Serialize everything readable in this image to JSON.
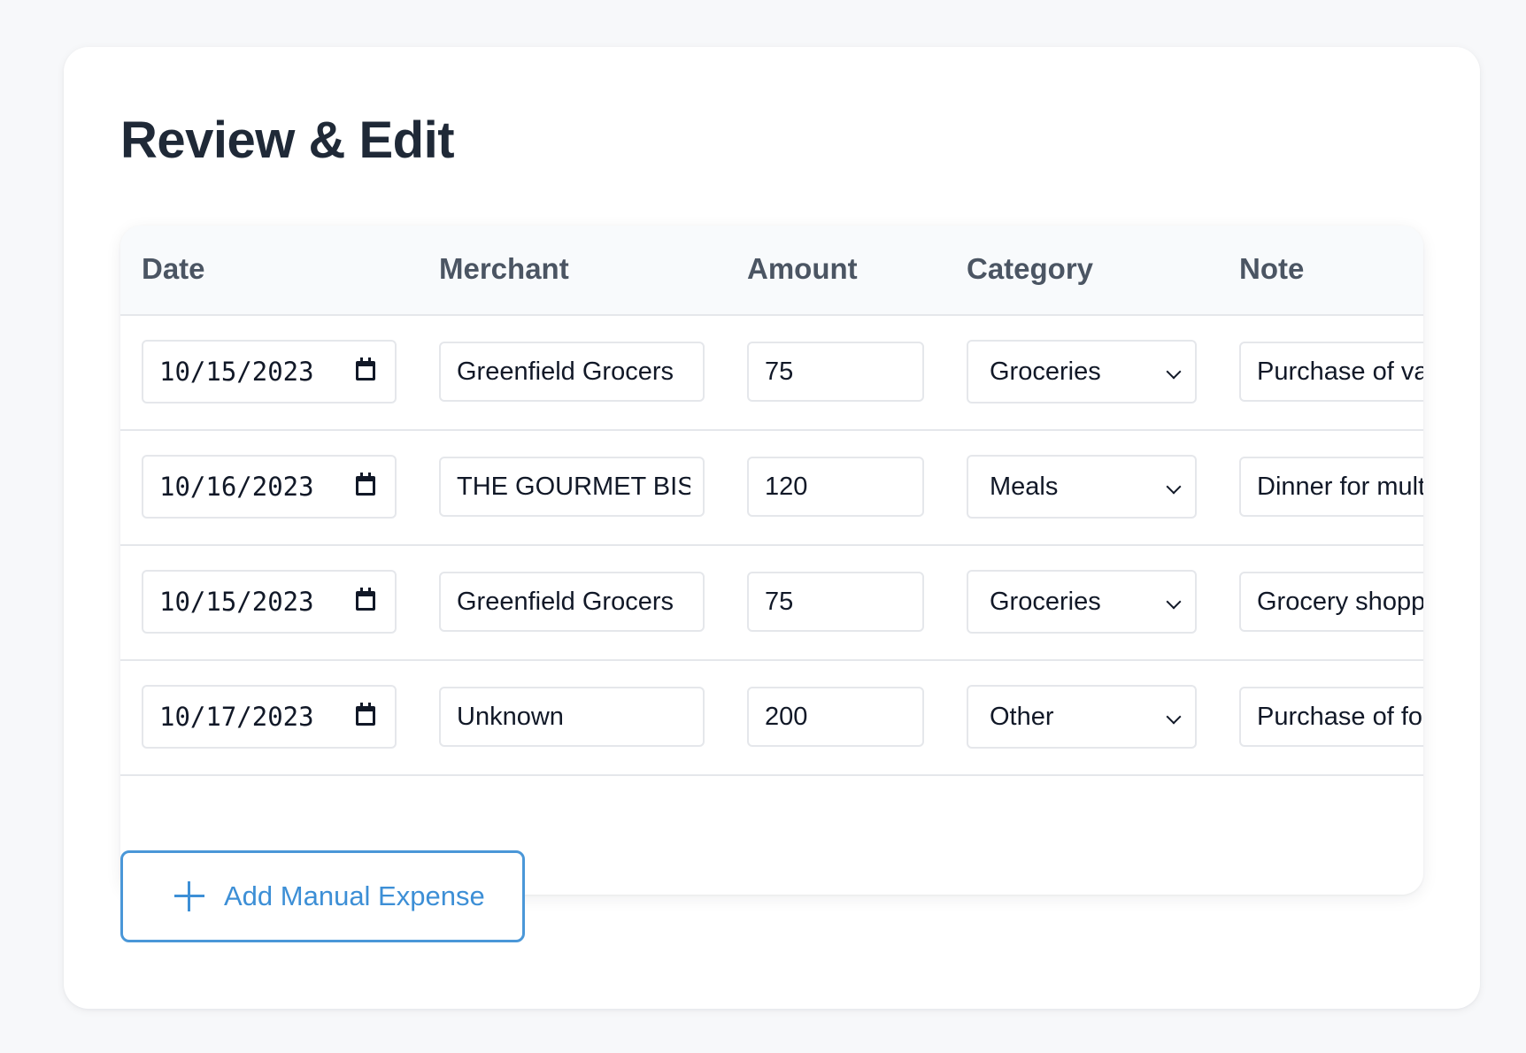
{
  "page": {
    "title": "Review & Edit"
  },
  "table": {
    "headers": [
      "Date",
      "Merchant",
      "Amount",
      "Category",
      "Note"
    ],
    "rows": [
      {
        "date": "10/15/2023",
        "merchant": "Greenfield Grocers",
        "amount": "75",
        "category": "Groceries",
        "note": "Purchase of var"
      },
      {
        "date": "10/16/2023",
        "merchant": "THE GOURMET BIST",
        "amount": "120",
        "category": "Meals",
        "note": "Dinner for multi"
      },
      {
        "date": "10/15/2023",
        "merchant": "Greenfield Grocers",
        "amount": "75",
        "category": "Groceries",
        "note": "Grocery shoppi"
      },
      {
        "date": "10/17/2023",
        "merchant": "Unknown",
        "amount": "200",
        "category": "Other",
        "note": "Purchase of fou"
      }
    ]
  },
  "actions": {
    "add_manual_expense": "Add Manual Expense"
  },
  "icons": {
    "date_picker": "calendar-icon",
    "dropdown": "chevron-down-icon",
    "add": "plus-icon"
  },
  "colors": {
    "accent": "#3d8fd6",
    "title": "#1f2937",
    "header_text": "#4b5563",
    "border": "#e5e7eb"
  }
}
